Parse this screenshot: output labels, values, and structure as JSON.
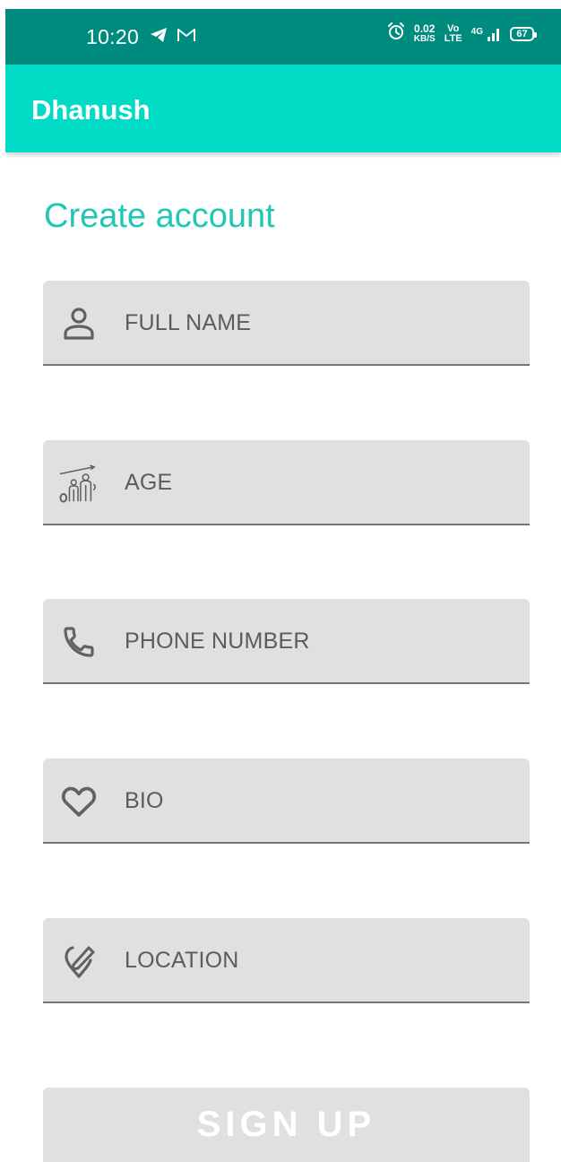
{
  "status_bar": {
    "time": "10:20",
    "net_speed_value": "0.02",
    "net_speed_unit": "KB/S",
    "volte_top": "Vo",
    "volte_bottom": "LTE",
    "network_type": "4G",
    "battery": "67",
    "icons": [
      "telegram-icon",
      "gmail-icon",
      "alarm-icon",
      "signal-icon",
      "battery-icon"
    ]
  },
  "app_bar": {
    "title": "Dhanush"
  },
  "form": {
    "heading": "Create account",
    "fields": [
      {
        "placeholder": "FULL NAME",
        "icon": "person-icon"
      },
      {
        "placeholder": "AGE",
        "icon": "age-icon"
      },
      {
        "placeholder": "PHONE NUMBER",
        "icon": "phone-icon"
      },
      {
        "placeholder": "BIO",
        "icon": "heart-icon"
      },
      {
        "placeholder": "LOCATION",
        "icon": "location-icon"
      }
    ],
    "submit_label": "SIGN UP"
  },
  "colors": {
    "status_bar": "#008b7f",
    "app_bar": "#00dbc5",
    "heading": "#20c7b5",
    "field_bg": "#e0e0e0",
    "field_underline": "#767676",
    "placeholder_text": "#5c5c5c",
    "icon": "#616161"
  }
}
